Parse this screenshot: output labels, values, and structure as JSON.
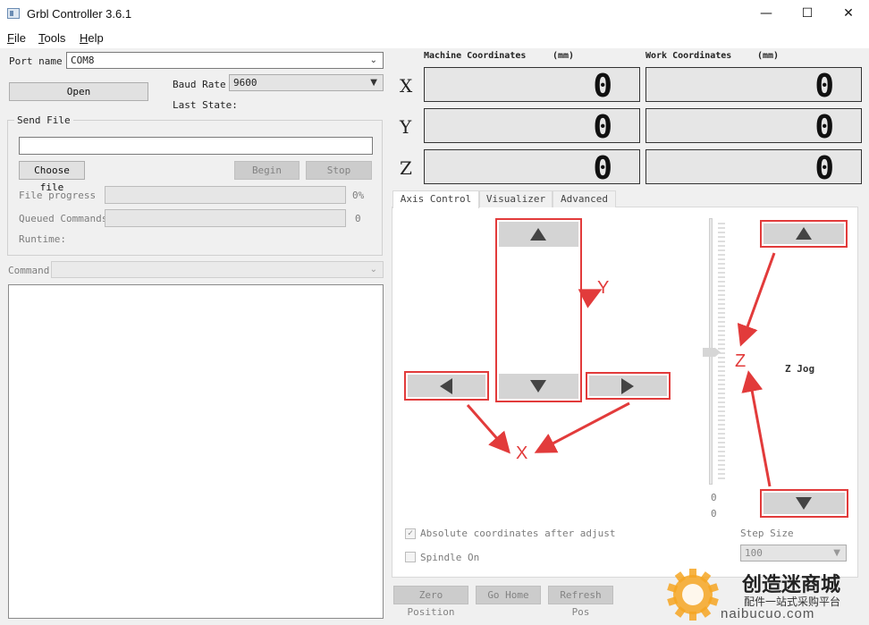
{
  "window": {
    "title": "Grbl Controller 3.6.1",
    "min_glyph": "—",
    "max_glyph": "☐",
    "close_glyph": "✕"
  },
  "menu": {
    "file": {
      "accel": "F",
      "rest": "ile"
    },
    "tools": {
      "accel": "T",
      "rest": "ools"
    },
    "help": {
      "accel": "H",
      "rest": "elp"
    }
  },
  "connection": {
    "port_label": "Port name",
    "port_value": "COM8",
    "open_button": "Open",
    "baud_label": "Baud Rate",
    "baud_value": "9600",
    "last_state_label": "Last State:"
  },
  "send_file": {
    "group_title": "Send File",
    "file_path": "",
    "choose_button": "Choose file",
    "begin_button": "Begin",
    "stop_button": "Stop",
    "progress_label": "File progress",
    "progress_value": "0%",
    "progress_fraction": 0,
    "queued_label": "Queued Commands",
    "queued_value": "0",
    "runtime_label": "Runtime:"
  },
  "command": {
    "label": "Command",
    "value": ""
  },
  "coordinates": {
    "machine_title": "Machine Coordinates",
    "machine_unit": "(mm)",
    "work_title": "Work Coordinates",
    "work_unit": "(mm)",
    "axes": [
      {
        "letter": "X",
        "machine": "0",
        "work": "0"
      },
      {
        "letter": "Y",
        "machine": "0",
        "work": "0"
      },
      {
        "letter": "Z",
        "machine": "0",
        "work": "0"
      }
    ]
  },
  "tabs": [
    {
      "label": "Axis Control",
      "active": true
    },
    {
      "label": "Visualizer",
      "active": false
    },
    {
      "label": "Advanced",
      "active": false
    }
  ],
  "axis_control": {
    "slider_min_top": "0",
    "slider_min_bottom": "0",
    "z_jog_label": "Z Jog",
    "annotation_y": "Y",
    "annotation_x": "X",
    "annotation_z": "Z",
    "absolute_coords_label": "Absolute coordinates after adjust",
    "absolute_coords_checked": true,
    "spindle_label": "Spindle On",
    "spindle_checked": false,
    "step_size_label": "Step Size",
    "step_size_value": "100"
  },
  "bottom_buttons": {
    "zero_position": "Zero Position",
    "go_home": "Go Home",
    "refresh_pos": "Refresh Pos"
  },
  "icons": {
    "up": "triangle-up-icon",
    "down": "triangle-down-icon",
    "left": "triangle-left-icon",
    "right": "triangle-right-icon"
  },
  "watermark": {
    "brand_cn": "创造迷商城",
    "tagline_cn": "配件一站式采购平台",
    "domain": "naibucuo.com"
  },
  "colors": {
    "annotation_red": "#e23b3b",
    "jog_gray": "#d4d4d4",
    "watermark_orange": "#f08a00"
  }
}
